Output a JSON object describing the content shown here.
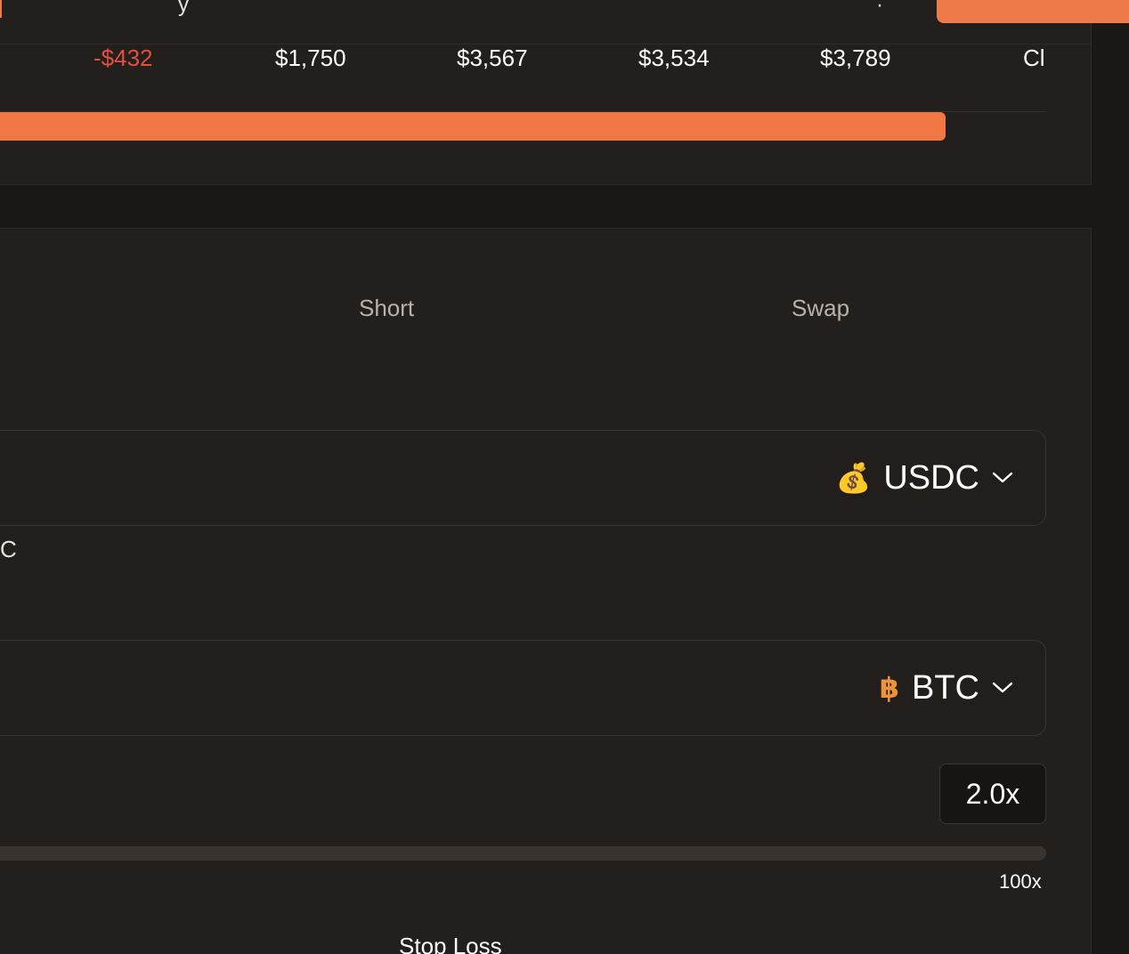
{
  "top": {
    "values": [
      "-$432",
      "$1,750",
      "$3,567",
      "$3,534",
      "$3,789",
      "Cl"
    ],
    "progress": 0.904
  },
  "tabs": {
    "short": "Short",
    "swap": "Swap"
  },
  "pay_token": {
    "icon": "money-bag-icon",
    "symbol": "USDC"
  },
  "balance_cutoff": "C",
  "receive_token": {
    "icon": "bitcoin-icon",
    "symbol": "BTC"
  },
  "leverage": {
    "value": "2.0x",
    "max_label": "100x"
  },
  "stop_loss_label": "Stop Loss",
  "colors": {
    "accent": "#ef7845",
    "negative": "#e0503f",
    "background": "#231f1d"
  }
}
